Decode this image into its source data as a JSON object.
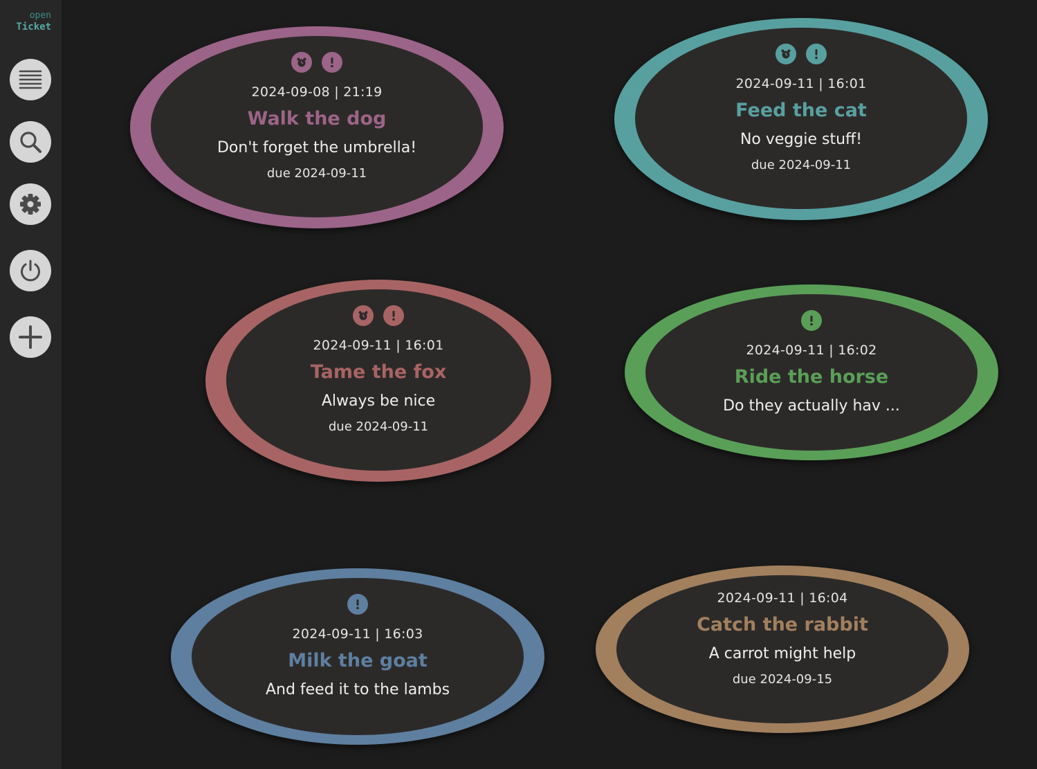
{
  "app": {
    "logo_line1": "open",
    "logo_line2": "Ticket"
  },
  "sidebar": {
    "buttons": [
      {
        "name": "list-button",
        "icon": "menu-icon"
      },
      {
        "name": "search-button",
        "icon": "search-icon"
      },
      {
        "name": "settings-button",
        "icon": "gear-icon"
      },
      {
        "name": "power-button",
        "icon": "power-icon"
      },
      {
        "name": "add-button",
        "icon": "plus-icon"
      }
    ]
  },
  "tickets": [
    {
      "date": "2024-09-08 | 21:19",
      "title": "Walk the dog",
      "description": "Don't forget the umbrella!",
      "due": "due 2024-09-11",
      "color": "#9c6488",
      "badges": [
        "alarm",
        "urgent"
      ]
    },
    {
      "date": "2024-09-11 | 16:01",
      "title": "Feed the cat",
      "description": "No veggie stuff!",
      "due": "due 2024-09-11",
      "color": "#58a0a0",
      "badges": [
        "alarm",
        "urgent"
      ]
    },
    {
      "date": "2024-09-11 | 16:01",
      "title": "Tame the fox",
      "description": "Always be nice",
      "due": "due 2024-09-11",
      "color": "#a86464",
      "badges": [
        "alarm",
        "urgent"
      ]
    },
    {
      "date": "2024-09-11 | 16:02",
      "title": "Ride the horse",
      "description": "Do they actually hav ...",
      "due": "",
      "color": "#5a9f58",
      "badges": [
        "urgent"
      ]
    },
    {
      "date": "2024-09-11 | 16:03",
      "title": "Milk the goat",
      "description": "And feed it to the lambs",
      "due": "",
      "color": "#5e7fa0",
      "badges": [
        "urgent"
      ]
    },
    {
      "date": "2024-09-11 | 16:04",
      "title": "Catch the rabbit",
      "description": "A carrot might help",
      "due": "due 2024-09-15",
      "color": "#a2805e",
      "badges": []
    }
  ]
}
